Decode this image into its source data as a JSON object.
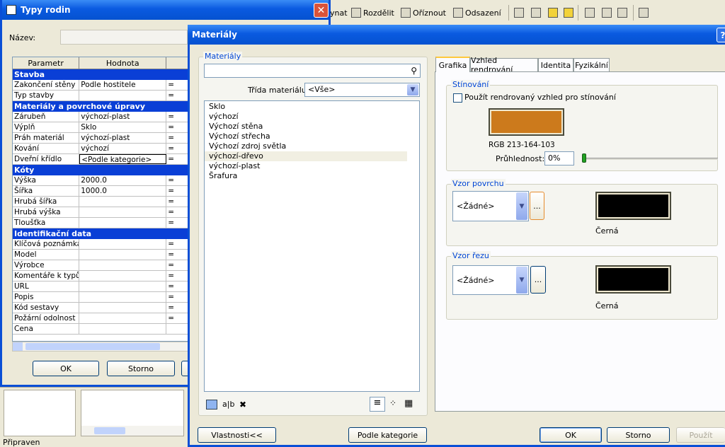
{
  "toolbar": {
    "items": [
      {
        "label": "ynat",
        "icon": "join-icon"
      },
      {
        "label": "Rozdělit",
        "icon": "split-icon"
      },
      {
        "label": "Oříznout",
        "icon": "trim-icon"
      },
      {
        "label": "Odsazení",
        "icon": "offset-icon"
      }
    ]
  },
  "type_dialog": {
    "title": "Typy rodin",
    "name_label": "Název:",
    "name_value": "",
    "columns": [
      "Parametr",
      "Hodnota"
    ],
    "sections": [
      {
        "title": "Stavba",
        "rows": [
          {
            "param": "Zakončení stěny",
            "value": "Podle hostitele",
            "eq": "="
          },
          {
            "param": "Typ stavby",
            "value": "",
            "eq": "="
          }
        ]
      },
      {
        "title": "Materiály a povrchové úpravy",
        "rows": [
          {
            "param": "Zárubeň",
            "value": "výchozí-plast",
            "eq": "="
          },
          {
            "param": "Výplň",
            "value": "Sklo",
            "eq": "="
          },
          {
            "param": "Práh materiál",
            "value": "výchozí-plast",
            "eq": "="
          },
          {
            "param": "Kování",
            "value": "výchozí",
            "eq": "="
          },
          {
            "param": "Dveřní křídlo",
            "value": "<Podle kategorie>",
            "eq": "="
          }
        ]
      },
      {
        "title": "Kóty",
        "rows": [
          {
            "param": "Výška",
            "value": "2000.0",
            "eq": "="
          },
          {
            "param": "Šířka",
            "value": "1000.0",
            "eq": "="
          },
          {
            "param": "Hrubá šířka",
            "value": "",
            "eq": "="
          },
          {
            "param": "Hrubá výška",
            "value": "",
            "eq": "="
          },
          {
            "param": "Tloušťka",
            "value": "",
            "eq": "="
          }
        ]
      },
      {
        "title": "Identifikační data",
        "rows": [
          {
            "param": "Klíčová poznámka",
            "value": "",
            "eq": "="
          },
          {
            "param": "Model",
            "value": "",
            "eq": "="
          },
          {
            "param": "Výrobce",
            "value": "",
            "eq": "="
          },
          {
            "param": "Komentáře k typů",
            "value": "",
            "eq": "="
          },
          {
            "param": "URL",
            "value": "",
            "eq": "="
          },
          {
            "param": "Popis",
            "value": "",
            "eq": "="
          },
          {
            "param": "Kód sestavy",
            "value": "",
            "eq": "="
          },
          {
            "param": "Požární odolnost",
            "value": "",
            "eq": "="
          },
          {
            "param": "Cena",
            "value": "",
            "eq": ""
          }
        ]
      }
    ],
    "ok_label": "OK",
    "cancel_label": "Storno"
  },
  "status": {
    "text": "Připraven"
  },
  "materials_dialog": {
    "title": "Materiály",
    "help_label": "?",
    "group_title": "Materiály",
    "search_value": "",
    "class_label": "Třída materiálu:",
    "class_value": "<Vše>",
    "materials": [
      "Sklo",
      "výchozí",
      "Výchozí stěna",
      "Výchozí střecha",
      "Výchozí zdroj světla",
      "výchozí-dřevo",
      "výchozí-plast",
      "Šrafura"
    ],
    "selected_index": 5,
    "properties_button": "Vlastnosti<<",
    "by_category_button": "Podle kategorie",
    "tabs": [
      "Grafika",
      "Vzhled rendrování",
      "Identita",
      "Fyzikální"
    ],
    "active_tab": 0,
    "shading": {
      "group_title": "Stínování",
      "checkbox_label": "Použít rendrovaný vzhled pro stínování",
      "checked": false,
      "color": "#d5a467",
      "color_label": "RGB 213-164-103",
      "transparency_label": "Průhlednost:",
      "transparency_value": "0%",
      "transparency_level": 0
    },
    "surface_pattern": {
      "group_title": "Vzor povrchu",
      "pattern_value": "<Žádné>",
      "browse_label": "...",
      "color": "#000000",
      "color_label": "Černá"
    },
    "cut_pattern": {
      "group_title": "Vzor řezu",
      "pattern_value": "<Žádné>",
      "browse_label": "...",
      "color": "#000000",
      "color_label": "Černá"
    },
    "ok_label": "OK",
    "cancel_label": "Storno",
    "apply_label": "Použít"
  }
}
